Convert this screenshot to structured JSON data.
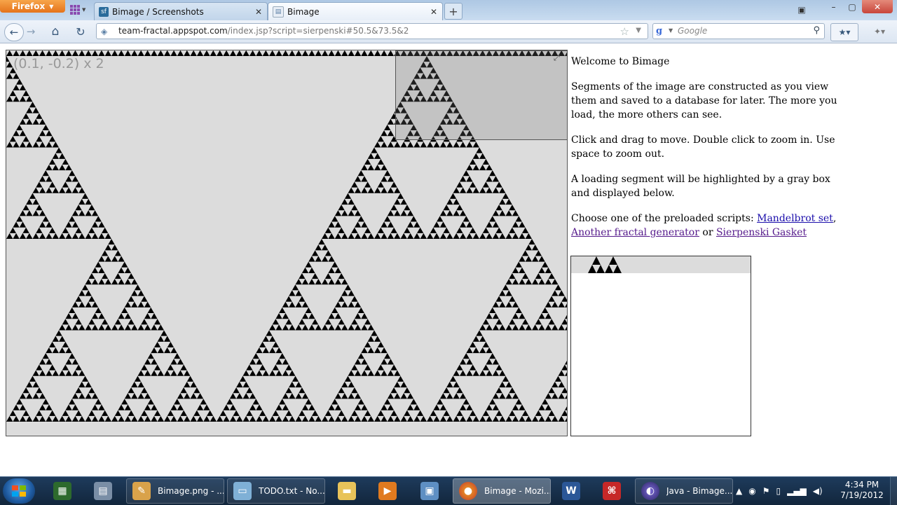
{
  "browser": {
    "app_button": "Firefox",
    "tabs": [
      {
        "title": "Bimage / Screenshots",
        "favicon": "sf-icon",
        "active": false
      },
      {
        "title": "Bimage",
        "favicon": "page-icon",
        "active": true
      }
    ],
    "window_controls": {
      "minimize": "–",
      "maximize": "▢",
      "close": "✕"
    },
    "nav": {
      "back": "←",
      "forward": "→",
      "home": "⌂",
      "reload": "↻"
    },
    "url": {
      "domain": "team-fractal.appspot.com",
      "path": "/index.jsp?script=sierpenski#50.5&73.5&2"
    },
    "search": {
      "engine": "Google",
      "placeholder": "Google"
    }
  },
  "page": {
    "coords": "(0.1, -0.2) x 2",
    "welcome": "Welcome to Bimage",
    "para1": "Segments of the image are constructed as you view them and saved to a database for later. The more you load, the more others can see.",
    "para2": "Click and drag to move. Double click to zoom in. Use space to zoom out.",
    "para3": "A loading segment will be highlighted by a gray box and displayed below.",
    "scripts_intro": "Choose one of the preloaded scripts: ",
    "link_mandelbrot": "Mandelbrot set",
    "sep1": ", ",
    "link_another": "Another fractal generator",
    "sep2": " or ",
    "link_sierpenski": "Sierpenski Gasket"
  },
  "taskbar": {
    "buttons": [
      {
        "label": "Bimage.png - ...",
        "icon": "paint-icon"
      },
      {
        "label": "TODO.txt - No...",
        "icon": "notepad-icon"
      },
      {
        "label": "Bimage - Mozi...",
        "icon": "firefox-icon",
        "active": true
      },
      {
        "label": "Java - Bimage...",
        "icon": "eclipse-icon"
      }
    ],
    "time": "4:34 PM",
    "date": "7/19/2012"
  },
  "colors": {
    "link": "#1a0dab",
    "visited_link": "#551a8b",
    "fractal_bg": "#dcdcdc",
    "fractal_fg": "#000000"
  }
}
